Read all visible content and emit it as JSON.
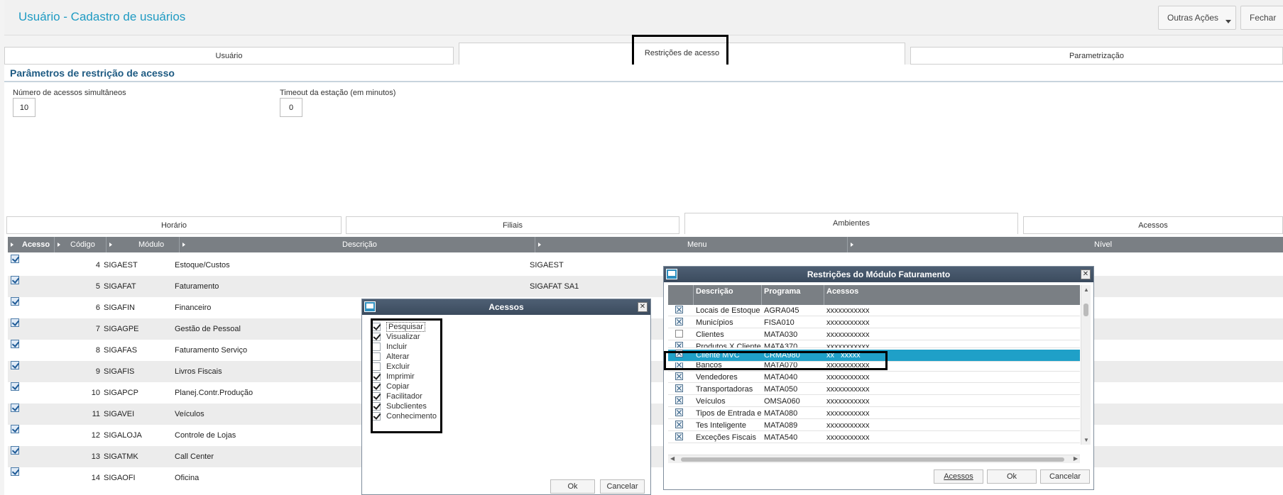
{
  "header": {
    "title": "Usuário - Cadastro de usuários",
    "more_actions": "Outras Ações",
    "close": "Fechar"
  },
  "top_tabs": [
    "Usuário",
    "Restrições de acesso",
    "Parametrização"
  ],
  "params": {
    "title": "Parâmetros de restrição de acesso",
    "simultaneous_label": "Número de acessos simultâneos",
    "simultaneous_value": "10",
    "timeout_label": "Timeout da estação (em minutos)",
    "timeout_value": "0"
  },
  "sub_tabs": [
    "Horário",
    "Filiais",
    "Ambientes",
    "Acessos"
  ],
  "grid": {
    "columns": [
      "Acesso",
      "Código",
      "Módulo",
      "Descrição",
      "Menu",
      "Nível"
    ],
    "rows": [
      {
        "code": "4",
        "module": "SIGAEST",
        "desc": "Estoque/Custos",
        "menu": "SIGAEST"
      },
      {
        "code": "5",
        "module": "SIGAFAT",
        "desc": "Faturamento",
        "menu": "SIGAFAT SA1"
      },
      {
        "code": "6",
        "module": "SIGAFIN",
        "desc": "Financeiro",
        "menu": ""
      },
      {
        "code": "7",
        "module": "SIGAGPE",
        "desc": "Gestão de Pessoal",
        "menu": ""
      },
      {
        "code": "8",
        "module": "SIGAFAS",
        "desc": "Faturamento Serviço",
        "menu": ""
      },
      {
        "code": "9",
        "module": "SIGAFIS",
        "desc": "Livros Fiscais",
        "menu": ""
      },
      {
        "code": "10",
        "module": "SIGAPCP",
        "desc": "Planej.Contr.Produção",
        "menu": ""
      },
      {
        "code": "11",
        "module": "SIGAVEI",
        "desc": "Veículos",
        "menu": ""
      },
      {
        "code": "12",
        "module": "SIGALOJA",
        "desc": "Controle de Lojas",
        "menu": ""
      },
      {
        "code": "13",
        "module": "SIGATMK",
        "desc": "Call Center",
        "menu": ""
      },
      {
        "code": "14",
        "module": "SIGAOFI",
        "desc": "Oficina",
        "menu": ""
      }
    ]
  },
  "acessos_dialog": {
    "title": "Acessos",
    "items": [
      {
        "label": "Pesquisar",
        "checked": true
      },
      {
        "label": "Visualizar",
        "checked": true
      },
      {
        "label": "Incluir",
        "checked": false
      },
      {
        "label": "Alterar",
        "checked": false
      },
      {
        "label": "Excluir",
        "checked": false
      },
      {
        "label": "Imprimir",
        "checked": true
      },
      {
        "label": "Copiar",
        "checked": true
      },
      {
        "label": "Facilitador",
        "checked": true
      },
      {
        "label": "Subclientes",
        "checked": true
      },
      {
        "label": "Conhecimento",
        "checked": true
      }
    ],
    "ok": "Ok",
    "cancel": "Cancelar"
  },
  "restricoes_dialog": {
    "title": "Restrições do Módulo Faturamento",
    "columns": [
      "Descrição",
      "Programa",
      "Acessos"
    ],
    "rows": [
      {
        "desc": "Locais de Estoque",
        "prog": "AGRA045",
        "acc": "xxxxxxxxxxx",
        "checked": true
      },
      {
        "desc": "Municípios",
        "prog": "FISA010",
        "acc": "xxxxxxxxxxx",
        "checked": true
      },
      {
        "desc": "Clientes",
        "prog": "MATA030",
        "acc": "xxxxxxxxxxx",
        "checked": false
      },
      {
        "desc": "Produtos X Clientes",
        "prog": "MATA370",
        "acc": "xxxxxxxxxxx",
        "checked": true
      },
      {
        "desc": "Cliente MVC",
        "prog": "CRMA980",
        "acc": "xx   xxxxx",
        "checked": true,
        "selected": true
      },
      {
        "desc": "Bancos",
        "prog": "MATA070",
        "acc": "xxxxxxxxxxx",
        "checked": true
      },
      {
        "desc": "Vendedores",
        "prog": "MATA040",
        "acc": "xxxxxxxxxxx",
        "checked": true
      },
      {
        "desc": "Transportadoras",
        "prog": "MATA050",
        "acc": "xxxxxxxxxxx",
        "checked": true
      },
      {
        "desc": "Veículos",
        "prog": "OMSA060",
        "acc": "xxxxxxxxxxx",
        "checked": true
      },
      {
        "desc": "Tipos de Entrada e",
        "prog": "MATA080",
        "acc": "xxxxxxxxxxx",
        "checked": true
      },
      {
        "desc": "Tes Inteligente",
        "prog": "MATA089",
        "acc": "xxxxxxxxxxx",
        "checked": true
      },
      {
        "desc": "Exceções Fiscais",
        "prog": "MATA540",
        "acc": "xxxxxxxxxxx",
        "checked": true
      }
    ],
    "acessos_btn": "Acessos",
    "ok": "Ok",
    "cancel": "Cancelar"
  }
}
